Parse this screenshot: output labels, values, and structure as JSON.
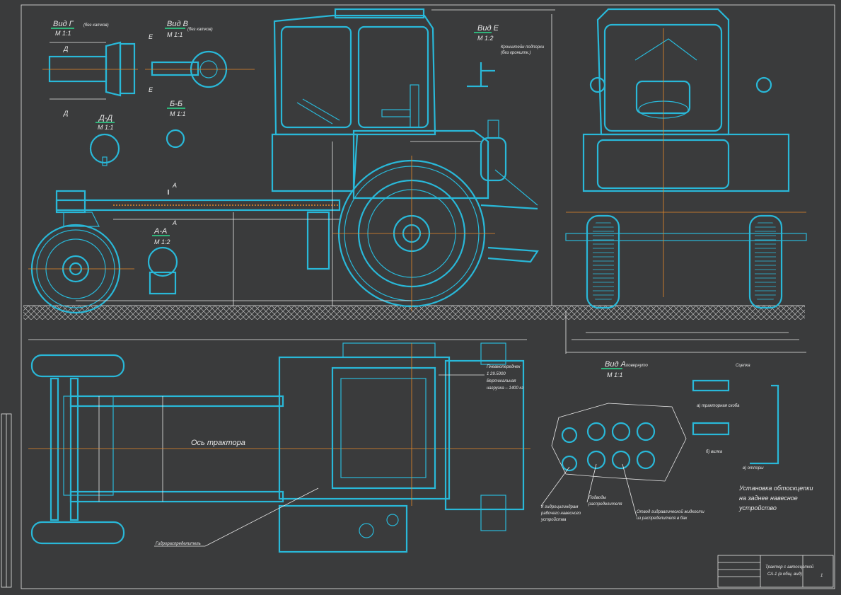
{
  "views": {
    "g": {
      "title": "Вид Г",
      "note": "(без катков)",
      "scale": "М 1:1"
    },
    "v": {
      "title": "Вид В",
      "note": "(без катков)",
      "scale": "М 1:1"
    },
    "e": {
      "title": "Вид Е",
      "scale": "М 1:2"
    },
    "dd": {
      "title": "Д-Д",
      "scale": "М 1:1"
    },
    "bb": {
      "title": "Б-Б",
      "scale": "М 1:1"
    },
    "aa": {
      "title": "А-А",
      "scale": "М 1:2"
    },
    "a": {
      "title": "Вид А",
      "note": "повернуто",
      "scale": "М 1:1"
    }
  },
  "labels": {
    "tractor_axis": "Ось трактора",
    "hydro_distributor": "Гидрораспределитель",
    "pneumo_chamber": "Пневмопереднек",
    "pneumo_lines": [
      "1 29.5000",
      "Вертикальная",
      "нагрузка – 1400 кг"
    ],
    "bracket_note": [
      "Кронштейн подпорки",
      "(без кронштк.)"
    ],
    "hitch_title": "Сцепка",
    "hitch_options": [
      "а) тракторная скоба",
      "б) вилка",
      "в) отпоры"
    ],
    "install_note": [
      "Установка обтоскцепки",
      "на заднее навесное",
      "устройство"
    ],
    "left_callouts": [
      "К гидроцилиндрам",
      "рабочего навесного",
      "устройства"
    ],
    "hose_callouts": [
      "Подводы",
      "распределителя"
    ],
    "return_callout": [
      "Отвод гидравлической жидкости",
      "из распределителя в бак"
    ],
    "section_marks": [
      "А",
      "А",
      "Б",
      "Б",
      "Д",
      "Д",
      "Е",
      "Е"
    ]
  },
  "title_block": {
    "line1": "Трактор с автосцепкой",
    "line2": "СА-1 (в общ. вид)",
    "sheet": "1"
  },
  "colors": {
    "background": "#3a3b3c",
    "outline": "#29b8d8",
    "dims": "#e8e8e8",
    "axis": "#e88a2a",
    "hatch": "#c8c8c8"
  }
}
